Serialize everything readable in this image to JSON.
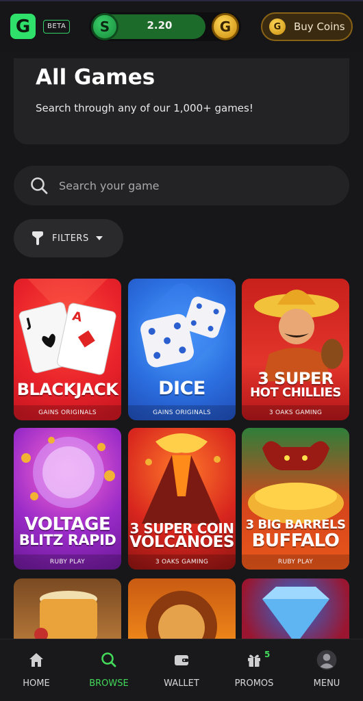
{
  "header": {
    "logo_letter": "G",
    "beta_label": "BETA",
    "balance_coin_letter": "S",
    "balance_value": "2.20",
    "gold_coin_letter": "G",
    "buy_coins_label": "Buy Coins"
  },
  "hero": {
    "title": "All Games",
    "subtitle": "Search through any of our 1,000+ games!"
  },
  "search": {
    "placeholder": "Search your game"
  },
  "filters": {
    "label": "FILTERS"
  },
  "games": [
    {
      "title_lines": [
        "BLACKJACK"
      ],
      "provider": "GAINS ORIGINALS",
      "bg": "#e8222a"
    },
    {
      "title_lines": [
        "DICE"
      ],
      "provider": "GAINS ORIGINALS",
      "bg": "#2c6fe0"
    },
    {
      "title_lines": [
        "3 SUPER",
        "HOT CHILLIES"
      ],
      "provider": "3 OAKS GAMING",
      "bg": "#e0332a"
    },
    {
      "title_lines": [
        "VOLTAGE",
        "BLITZ RAPID"
      ],
      "provider": "RUBY PLAY",
      "bg": "#8a1fb0"
    },
    {
      "title_lines": [
        "3 SUPER COIN",
        "VOLCANOES"
      ],
      "provider": "3 OAKS GAMING",
      "bg": "#d8261e"
    },
    {
      "title_lines": [
        "3 BIG BARRELS",
        "BUFFALO"
      ],
      "provider": "RUBY PLAY",
      "bg": "#e8571a"
    }
  ],
  "nav": [
    {
      "label": "HOME",
      "icon": "home-icon"
    },
    {
      "label": "BROWSE",
      "icon": "search-icon",
      "active": true
    },
    {
      "label": "WALLET",
      "icon": "wallet-icon"
    },
    {
      "label": "PROMOS",
      "icon": "gift-icon",
      "badge": "5"
    },
    {
      "label": "MENU",
      "icon": "avatar-icon"
    }
  ],
  "colors": {
    "accent": "#43d95a",
    "background": "#17171a",
    "card": "#232326"
  }
}
